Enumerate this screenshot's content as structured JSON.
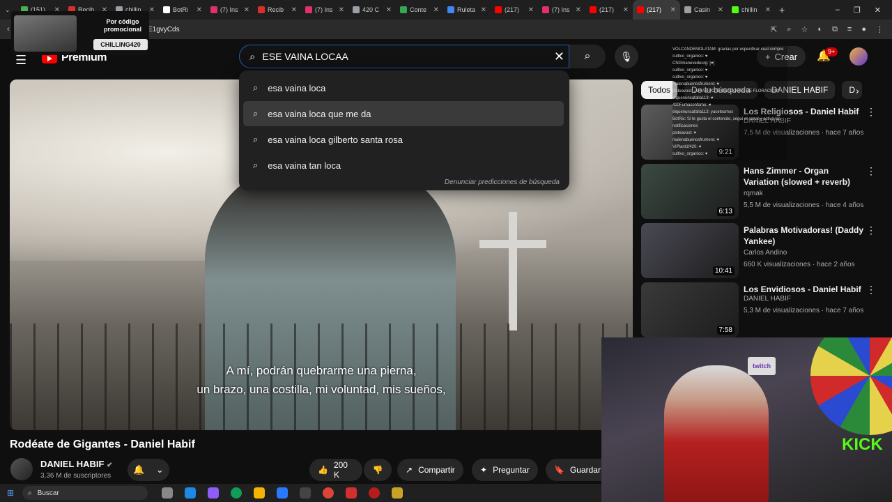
{
  "browser": {
    "tabs": [
      {
        "title": "(151)",
        "color": "#4caf50"
      },
      {
        "title": "Recib",
        "color": "#d93025"
      },
      {
        "title": "chillin",
        "color": "#9aa0a6"
      },
      {
        "title": "BotRi",
        "color": "#ffffff"
      },
      {
        "title": "(7) Ins",
        "color": "#e1306c"
      },
      {
        "title": "Recib",
        "color": "#d93025"
      },
      {
        "title": "(7) Ins",
        "color": "#e1306c"
      },
      {
        "title": "420 C",
        "color": "#9aa0a6"
      },
      {
        "title": "Conte",
        "color": "#34a853"
      },
      {
        "title": "Ruleta",
        "color": "#4285f4"
      },
      {
        "title": "(217)",
        "color": "#ff0000"
      },
      {
        "title": "(7) Ins",
        "color": "#e1306c"
      },
      {
        "title": "(217)",
        "color": "#ff0000"
      },
      {
        "title": "(217)",
        "color": "#ff0000",
        "active": true
      },
      {
        "title": "Casin",
        "color": "#9aa0a6"
      },
      {
        "title": "chillin",
        "color": "#53fc18"
      }
    ],
    "new_tab": "+",
    "window_controls": [
      "⌄",
      "–",
      "❐",
      "✕"
    ],
    "url": "E1gvyCds"
  },
  "promo": {
    "text": "Por código promocional",
    "code": "CHILLING420"
  },
  "header": {
    "logo": "Premium",
    "search_value": "ESE VAINA LOCAA",
    "create_label": "Crear",
    "notif_count": "9+"
  },
  "suggestions": {
    "items": [
      "esa vaina loca",
      "esa vaina loca que me da",
      "esa vaina loca gilberto santa rosa",
      "esa vaina tan loca"
    ],
    "highlighted_index": 1,
    "report": "Denunciar predicciones de búsqueda"
  },
  "video": {
    "caption_line1": "A mí, podrán quebrarme una pierna,",
    "caption_line2": "un brazo, una costilla, mi voluntad, mis sueños,",
    "title": "Rodéate de Gigantes - Daniel Habif",
    "channel": "DANIEL HABIF",
    "subscribers": "3,36 M de suscriptores",
    "likes": "200 K",
    "share_label": "Compartir",
    "ask_label": "Preguntar",
    "save_label": "Guardar"
  },
  "chips": [
    "Todos",
    "De tu búsqueda",
    "DANIEL HABIF",
    "D"
  ],
  "recommendations": [
    {
      "title": "Los Religiosos - Daniel Habif",
      "channel": "DANIEL HABIF",
      "meta": "7,5 M de visualizaciones · hace 7 años",
      "duration": "9:21"
    },
    {
      "title": "Hans Zimmer - Organ Variation (slowed + reverb)",
      "channel": "rqmak",
      "meta": "5,5 M de visualizaciones · hace 4 años",
      "duration": "6:13"
    },
    {
      "title": "Palabras Motivadoras! (Daddy Yankee)",
      "channel": "Carlos Andino",
      "meta": "660 K visualizaciones · hace 2 años",
      "duration": "10:41"
    },
    {
      "title": "Los Envidiosos - Daniel Habif",
      "channel": "DANIEL HABIF",
      "meta": "5,3 M de visualizaciones · hace 7 años",
      "duration": "7:58"
    }
  ],
  "chat_lines": [
    "VOLCANDEMOLATAM: gracias por especificar cual compre",
    "cultivo_organico: ♥",
    "CNGmanevedeurg: [♥]",
    "cultivo_organico: ♥",
    "cultivo_organico: ♥",
    "malenabuenosfrumero: ♥",
    "pisteavost: ¿USAS POTENCIADORES DE FLORACIÓN?",
    "elquenuncafalla113: ♥",
    "420Fumaconfamo: ♥",
    "elquenuncafalla113: yaceteamos",
    "BotRix: Si te gusta el contenido, seguí el canal y activá las notificaciones",
    "pisteavost: ♥",
    "malenabuenosfrumero: ♥",
    "VIPlant1f420: ♥",
    "cultivo_organico: ♥"
  ],
  "cam": {
    "twitch": "twitch",
    "kick": "KICK"
  },
  "taskbar": {
    "search_label": "Buscar"
  }
}
